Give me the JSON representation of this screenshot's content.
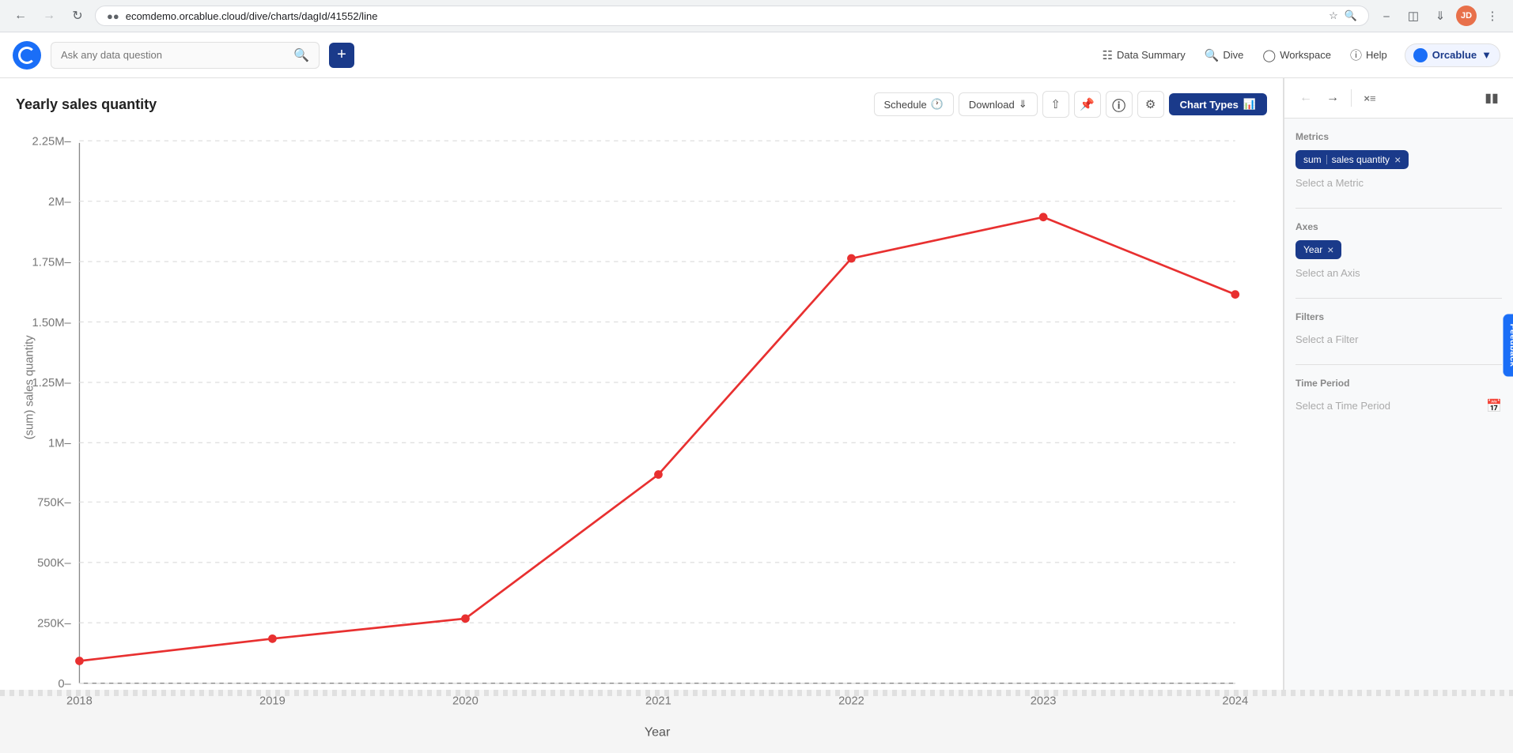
{
  "browser": {
    "url": "ecomdemo.orcablue.cloud/dive/charts/dagId/41552/line",
    "back_disabled": false,
    "forward_disabled": false
  },
  "app_header": {
    "search_placeholder": "Ask any data question",
    "nav_items": [
      {
        "id": "data-summary",
        "icon": "grid",
        "label": "Data Summary"
      },
      {
        "id": "dive",
        "icon": "search",
        "label": "Dive"
      },
      {
        "id": "workspace",
        "icon": "globe",
        "label": "Workspace"
      },
      {
        "id": "help",
        "icon": "question",
        "label": "Help"
      }
    ],
    "user_label": "Orcablue",
    "plus_label": "+"
  },
  "chart": {
    "title": "Yearly sales quantity",
    "toolbar": {
      "schedule_label": "Schedule",
      "download_label": "Download",
      "chart_types_label": "Chart Types"
    },
    "y_axis_label": "(sum) sales quantity",
    "x_axis_label": "Year",
    "y_ticks": [
      "2.25M",
      "2M",
      "1.75M",
      "1.50M",
      "1.25M",
      "1M",
      "750K",
      "500K",
      "250K",
      "0"
    ],
    "x_ticks": [
      "2018",
      "2019",
      "2020",
      "2021",
      "2022",
      "2023",
      "2024"
    ],
    "data_points": [
      {
        "year": "2018",
        "value": 95000
      },
      {
        "year": "2019",
        "value": 185000
      },
      {
        "year": "2020",
        "value": 270000
      },
      {
        "year": "2021",
        "value": 870000
      },
      {
        "year": "2022",
        "value": 1770000
      },
      {
        "year": "2023",
        "value": 1940000
      },
      {
        "year": "2024",
        "value": 1620000
      }
    ],
    "y_max": 2250000
  },
  "right_panel": {
    "metrics_label": "Metrics",
    "metric_chip_prefix": "sum",
    "metric_chip_value": "sales quantity",
    "metric_select_placeholder": "Select a Metric",
    "axes_label": "Axes",
    "axis_chip_value": "Year",
    "axis_select_placeholder": "Select an Axis",
    "filters_label": "Filters",
    "filter_select_placeholder": "Select a Filter",
    "time_period_label": "Time Period",
    "time_period_placeholder": "Select a Time Period"
  },
  "feedback": {
    "label": "Feedback"
  }
}
